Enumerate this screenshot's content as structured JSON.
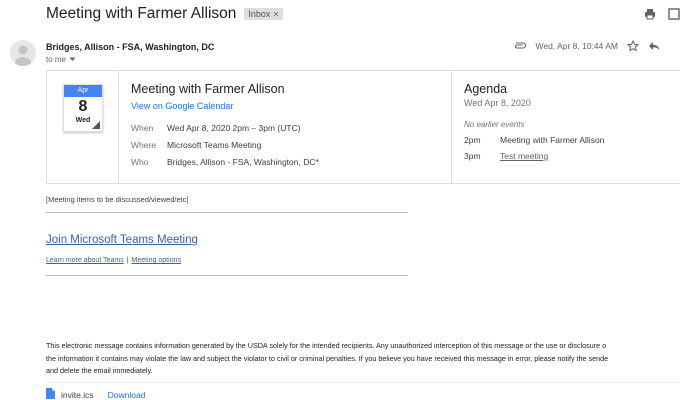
{
  "email": {
    "subject": "Meeting with Farmer Allison",
    "label_chip": "Inbox",
    "label_close": "×",
    "sender": "Bridges, Allison - FSA, Washington, DC",
    "recipient": "to me",
    "timestamp": "Wed, Apr 8, 10:44 AM"
  },
  "invite": {
    "calendar_icon": {
      "month": "Apr",
      "day": "8",
      "weekday": "Wed"
    },
    "title": "Meeting with Farmer Allison",
    "view_link": "View on Google Calendar",
    "details": [
      {
        "key": "When",
        "value": "Wed Apr 8, 2020 2pm – 3pm (UTC)"
      },
      {
        "key": "Where",
        "value": "Microsoft Teams Meeting"
      },
      {
        "key": "Who",
        "value": "Bridges, Allison - FSA, Washington, DC*"
      }
    ]
  },
  "agenda": {
    "title": "Agenda",
    "date": "Wed Apr 8, 2020",
    "empty_note": "No earlier events",
    "items": [
      {
        "time": "2pm",
        "name": "Meeting with Farmer Allison"
      },
      {
        "time": "3pm",
        "name": "Test meeting"
      }
    ]
  },
  "body": {
    "note": "[Meeting items to be discussed/viewed/etc]",
    "join_link": "Join Microsoft Teams Meeting",
    "learn_more": "Learn more about Teams",
    "separator": "|",
    "meeting_options": "Meeting options",
    "disclaimer_lines": [
      "This electronic message contains information generated by the USDA solely for the intended recipients. Any unauthorized interception of this message or the use or disclosure o",
      "the information it contains may violate the law and subject the violator to civil or criminal penalties. If you believe you have received this message in error, please notify the sende",
      "and delete the email immediately."
    ]
  },
  "attachment": {
    "filename": "invite.ics",
    "download_label": "Download"
  },
  "icons": {
    "print": "print-icon",
    "new_window": "open-in-new-window-icon",
    "attachment_clip": "paperclip-icon",
    "star": "star-icon",
    "reply": "reply-icon",
    "dropdown": "chevron-down-icon",
    "file": "file-icon"
  },
  "colors": {
    "link_blue": "#1a73e8",
    "calendar_blue": "#4285f4",
    "teams_link": "#3b5fa8"
  }
}
